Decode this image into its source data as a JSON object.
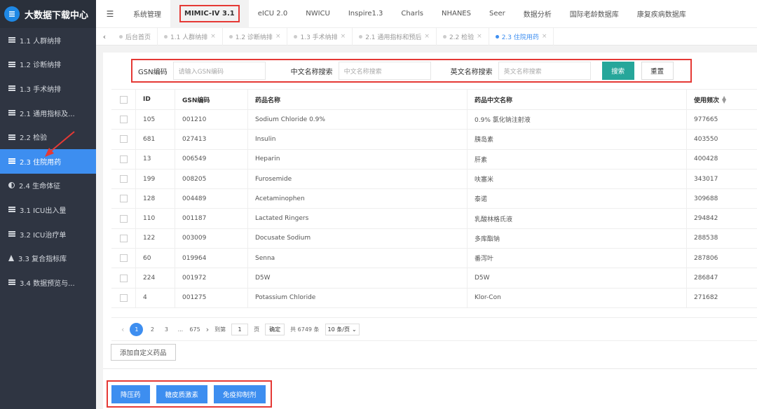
{
  "app": {
    "title": "大数据下载中心"
  },
  "sidebar": {
    "items": [
      {
        "label": "1.1 人群纳排",
        "icon": "list-icon"
      },
      {
        "label": "1.2 诊断纳排",
        "icon": "list-icon"
      },
      {
        "label": "1.3 手术纳排",
        "icon": "list-icon"
      },
      {
        "label": "2.1 通用指标及...",
        "icon": "list-icon"
      },
      {
        "label": "2.2 检验",
        "icon": "list-icon"
      },
      {
        "label": "2.3 住院用药",
        "icon": "list-icon",
        "active": true
      },
      {
        "label": "2.4 生命体征",
        "icon": "half-circle-icon"
      },
      {
        "label": "3.1 ICU出入量",
        "icon": "list-icon"
      },
      {
        "label": "3.2 ICU治疗单",
        "icon": "list-icon"
      },
      {
        "label": "3.3 复合指标库",
        "icon": "flask-icon"
      },
      {
        "label": "3.4 数据预览与...",
        "icon": "list-icon"
      }
    ]
  },
  "topnav": {
    "items": [
      "系统管理",
      "MIMIC-IV 3.1",
      "eICU 2.0",
      "NWICU",
      "Inspire1.3",
      "Charls",
      "NHANES",
      "Seer",
      "数据分析",
      "国际老龄数据库",
      "康复疾病数据库"
    ],
    "active_index": 1
  },
  "tabs": {
    "items": [
      "后台首页",
      "1.1 人群纳排",
      "1.2 诊断纳排",
      "1.3 手术纳排",
      "2.1 通用指标和预后",
      "2.2 检验",
      "2.3 住院用药"
    ],
    "active_index": 6
  },
  "search": {
    "gsn_label": "GSN编码",
    "gsn_placeholder": "请输入GSN编码",
    "cn_label": "中文名称搜索",
    "cn_placeholder": "中文名称搜索",
    "en_label": "英文名称搜索",
    "en_placeholder": "英文名称搜索",
    "search_button": "搜索",
    "reset_button": "重置"
  },
  "table": {
    "columns": [
      "ID",
      "GSN编码",
      "药品名称",
      "药品中文名称",
      "使用频次"
    ],
    "rows": [
      [
        "105",
        "001210",
        "Sodium Chloride 0.9%",
        "0.9% 氯化钠注射液",
        "977665"
      ],
      [
        "681",
        "027413",
        "Insulin",
        "胰岛素",
        "403550"
      ],
      [
        "13",
        "006549",
        "Heparin",
        "肝素",
        "400428"
      ],
      [
        "199",
        "008205",
        "Furosemide",
        "呋塞米",
        "343017"
      ],
      [
        "128",
        "004489",
        "Acetaminophen",
        "泰诺",
        "309688"
      ],
      [
        "110",
        "001187",
        "Lactated Ringers",
        "乳酸林格氏液",
        "294842"
      ],
      [
        "122",
        "003009",
        "Docusate Sodium",
        "多库酯钠",
        "288538"
      ],
      [
        "60",
        "019964",
        "Senna",
        "番泻叶",
        "287806"
      ],
      [
        "224",
        "001972",
        "D5W",
        "D5W",
        "286847"
      ],
      [
        "4",
        "001275",
        "Potassium Chloride",
        "Klor-Con",
        "271682"
      ]
    ]
  },
  "pager": {
    "pages": [
      "1",
      "2",
      "3",
      "...",
      "675"
    ],
    "current": "1",
    "goto_label": "到第",
    "goto_value": "1",
    "page_unit": "页",
    "confirm": "确定",
    "total": "共 6749 条",
    "page_size": "10 条/页"
  },
  "actions": {
    "add_custom": "添加自定义药品",
    "bottom_buttons": [
      "降压药",
      "糖皮质激素",
      "免疫抑制剂"
    ]
  },
  "colors": {
    "sidebar_bg": "#2f3542",
    "accent_blue": "#3d8ef0",
    "search_green": "#26a69a",
    "highlight_red": "#e53935"
  }
}
